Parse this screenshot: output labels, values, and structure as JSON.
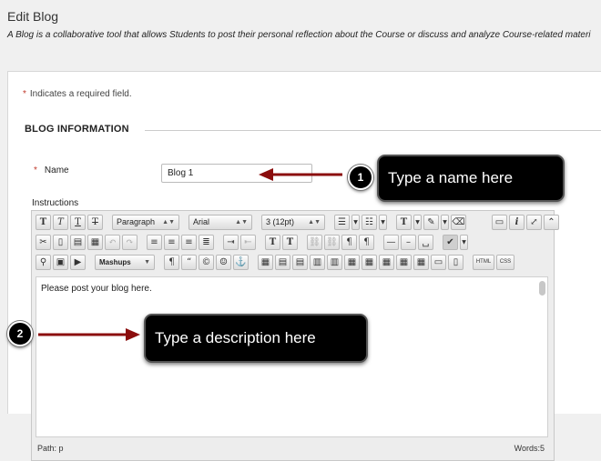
{
  "page": {
    "title": "Edit Blog",
    "description": "A Blog is a collaborative tool that allows Students to post their personal reflection about the Course or discuss and analyze Course-related materi"
  },
  "form": {
    "required_star": "*",
    "required_note": "Indicates a required field.",
    "section_title": "BLOG INFORMATION",
    "name_label": "Name",
    "name_value": "Blog 1",
    "instructions_label": "Instructions"
  },
  "editor": {
    "paragraph_dd": "Paragraph",
    "font_dd": "Arial",
    "size_dd": "3 (12pt)",
    "mashups_dd": "Mashups",
    "content": "Please post your blog here.",
    "path": "Path: p",
    "words": "Words:5",
    "buttons": {
      "bold": "T",
      "italic": "T",
      "underline": "T",
      "strike": "T",
      "text_color": "T",
      "superscript": "T",
      "subscript": "T",
      "blockquote": "“",
      "copyright": "©",
      "emoticon": "☺",
      "anchor": "⚓",
      "math": "√",
      "info": "i",
      "html": "HTML",
      "css": "CSS",
      "link": "⛓",
      "unlink": "⛓"
    }
  },
  "callouts": {
    "one": {
      "number": "1",
      "text": "Type a name here"
    },
    "two": {
      "number": "2",
      "text": "Type a description here"
    }
  },
  "colors": {
    "arrow": "#8b0d0d",
    "callout_bg": "#000000",
    "required": "#c0392b"
  }
}
